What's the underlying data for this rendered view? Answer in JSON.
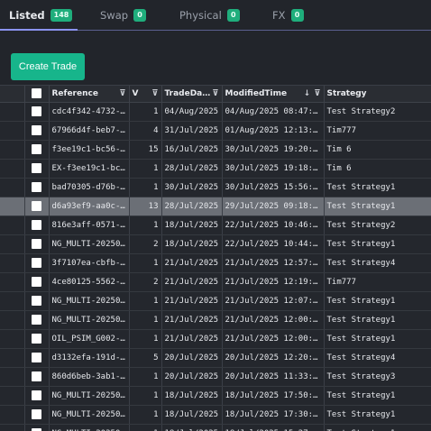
{
  "tabs": [
    {
      "label": "Listed",
      "count": "148"
    },
    {
      "label": "Swap",
      "count": "0"
    },
    {
      "label": "Physical",
      "count": "0"
    },
    {
      "label": "FX",
      "count": "0"
    }
  ],
  "toolbar": {
    "create_label": "Create Trade"
  },
  "table": {
    "headers": {
      "reference": "Reference",
      "volume": "V",
      "trade_date": "TradeDa…",
      "modified_time": "ModifiedTime",
      "strategy": "Strategy"
    },
    "sorted_column": "modified_time",
    "sort_direction": "descending",
    "selected_row": 5,
    "rows": [
      {
        "reference": "cdc4f342-4732-…",
        "volume": "1",
        "trade_date": "04/Aug/2025",
        "modified": "04/Aug/2025 08:47:…",
        "strategy": "Test Strategy2"
      },
      {
        "reference": "67966d4f-beb7-…",
        "volume": "4",
        "trade_date": "31/Jul/2025",
        "modified": "01/Aug/2025 12:13:…",
        "strategy": "Tim777"
      },
      {
        "reference": "f3ee19c1-bc56-…",
        "volume": "15",
        "trade_date": "16/Jul/2025",
        "modified": "30/Jul/2025 19:20:…",
        "strategy": "Tim 6"
      },
      {
        "reference": "EX-f3ee19c1-bc…",
        "volume": "1",
        "trade_date": "28/Jul/2025",
        "modified": "30/Jul/2025 19:18:…",
        "strategy": "Tim 6"
      },
      {
        "reference": "bad70305-d76b-…",
        "volume": "1",
        "trade_date": "30/Jul/2025",
        "modified": "30/Jul/2025 15:56:…",
        "strategy": "Test Strategy1"
      },
      {
        "reference": "d6a93ef9-aa0c-…",
        "volume": "13",
        "trade_date": "28/Jul/2025",
        "modified": "29/Jul/2025 09:18:…",
        "strategy": "Test Strategy1"
      },
      {
        "reference": "816e3aff-0571-…",
        "volume": "1",
        "trade_date": "18/Jul/2025",
        "modified": "22/Jul/2025 10:46:…",
        "strategy": "Test Strategy2"
      },
      {
        "reference": "NG_MULTI-20250…",
        "volume": "2",
        "trade_date": "18/Jul/2025",
        "modified": "22/Jul/2025 10:44:…",
        "strategy": "Test Strategy1"
      },
      {
        "reference": "3f7107ea-cbfb-…",
        "volume": "1",
        "trade_date": "21/Jul/2025",
        "modified": "21/Jul/2025 12:57:…",
        "strategy": "Test Strategy4"
      },
      {
        "reference": "4ce80125-5562-…",
        "volume": "2",
        "trade_date": "21/Jul/2025",
        "modified": "21/Jul/2025 12:19:…",
        "strategy": "Tim777"
      },
      {
        "reference": "NG_MULTI-20250…",
        "volume": "1",
        "trade_date": "21/Jul/2025",
        "modified": "21/Jul/2025 12:07:…",
        "strategy": "Test Strategy1"
      },
      {
        "reference": "NG_MULTI-20250…",
        "volume": "1",
        "trade_date": "21/Jul/2025",
        "modified": "21/Jul/2025 12:00:…",
        "strategy": "Test Strategy1"
      },
      {
        "reference": "OIL_PSIM_G002-…",
        "volume": "1",
        "trade_date": "21/Jul/2025",
        "modified": "21/Jul/2025 12:00:…",
        "strategy": "Test Strategy1"
      },
      {
        "reference": "d3132efa-191d-…",
        "volume": "5",
        "trade_date": "20/Jul/2025",
        "modified": "20/Jul/2025 12:20:…",
        "strategy": "Test Strategy4"
      },
      {
        "reference": "860d6beb-3ab1-…",
        "volume": "1",
        "trade_date": "20/Jul/2025",
        "modified": "20/Jul/2025 11:33:…",
        "strategy": "Test Strategy3"
      },
      {
        "reference": "NG_MULTI-20250…",
        "volume": "1",
        "trade_date": "18/Jul/2025",
        "modified": "18/Jul/2025 17:50:…",
        "strategy": "Test Strategy1"
      },
      {
        "reference": "NG_MULTI-20250…",
        "volume": "1",
        "trade_date": "18/Jul/2025",
        "modified": "18/Jul/2025 17:30:…",
        "strategy": "Test Strategy1"
      },
      {
        "reference": "NG_MULTI-20250…",
        "volume": "1",
        "trade_date": "18/Jul/2025",
        "modified": "18/Jul/2025 15:27:…",
        "strategy": "Test Strategy1"
      }
    ]
  },
  "icons": {
    "filter": "filter-icon",
    "sort": "sort-desc-icon",
    "checkbox": "checkbox"
  },
  "colors": {
    "accent": "#17b58b",
    "badge": "#1fae7c",
    "tab_underline": "#8b93f0",
    "selected_row": "#6b6f76",
    "background": "#22252b"
  }
}
